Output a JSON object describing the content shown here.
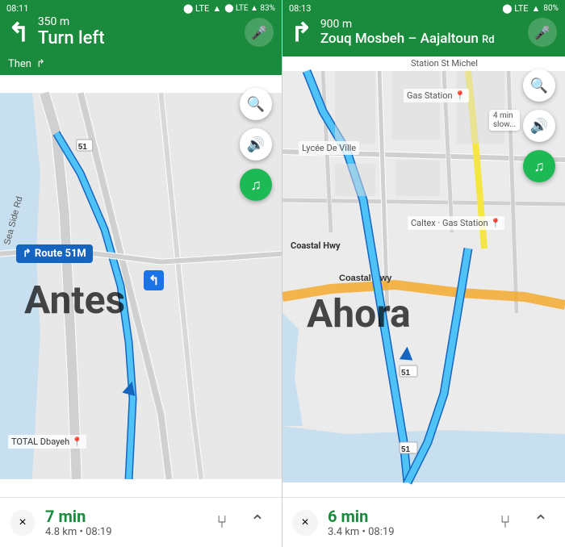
{
  "left": {
    "statusBar": {
      "time": "08:11",
      "icons": "▲ ⬤",
      "rightIcons": "⬤ LTE ▲ 83%"
    },
    "nav": {
      "distance": "350 m",
      "instruction": "Turn left",
      "arrowIcon": "↰",
      "thenLabel": "Then",
      "thenArrowIcon": "↱"
    },
    "map": {
      "overlayText": "Antes",
      "routeLabel": "Route 51M",
      "roadLabel": "Sea Side Rd"
    },
    "bottomBar": {
      "time": "7 min",
      "distance": "4.8 km",
      "arrival": "08:19",
      "closeBtnLabel": "×"
    }
  },
  "right": {
    "statusBar": {
      "time": "08:13",
      "icons": "▲ ⬤",
      "rightIcons": "⬤ LTE ▲ 80%"
    },
    "nav": {
      "distance": "900 m",
      "instruction": "Zouq Mosbeh – Aajaltoun",
      "instructionSmall": "Rd",
      "arrowIcon": "↱",
      "thenLabel": ""
    },
    "map": {
      "overlayText": "Ahora",
      "roadLabels": [
        "Caltex · Gas Station",
        "Lycée De Ville",
        "Coastal Hwy"
      ]
    },
    "bottomBar": {
      "time": "6 min",
      "distance": "3.4 km",
      "arrival": "08:19",
      "closeBtnLabel": "×"
    }
  },
  "icons": {
    "mic": "🎤",
    "search": "🔍",
    "sound": "🔊",
    "spotify": "♫",
    "close": "✕",
    "fork": "⑂",
    "chevronUp": "⌃",
    "locationArrow": "▲"
  }
}
